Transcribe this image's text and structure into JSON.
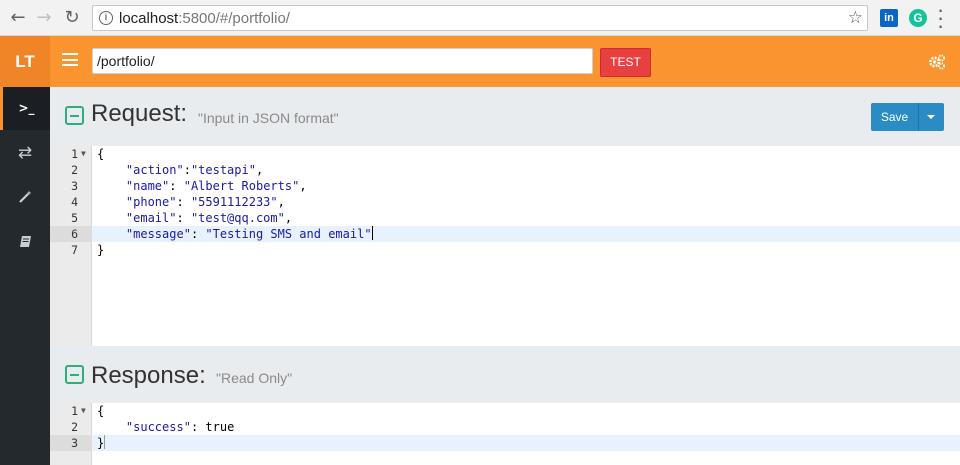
{
  "browser": {
    "url_host": "localhost",
    "url_rest": ":5800/#/portfolio/",
    "ext_linkedin": "in",
    "ext_grammarly": "G"
  },
  "header": {
    "logo": "LT",
    "path_value": "/portfolio/",
    "test_label": "TEST",
    "accent": "#f9942e"
  },
  "sidebar": {
    "items": [
      {
        "icon": "terminal-icon",
        "glyph": ">_"
      },
      {
        "icon": "exchange-icon",
        "glyph": "⇄"
      },
      {
        "icon": "magic-wand-icon",
        "glyph": "⁄"
      },
      {
        "icon": "book-icon",
        "glyph": "▰"
      }
    ]
  },
  "request": {
    "title": "Request:",
    "hint": "\"Input in JSON format\"",
    "save_label": "Save",
    "lines": [
      {
        "n": "1",
        "fold": true
      },
      {
        "n": "2"
      },
      {
        "n": "3"
      },
      {
        "n": "4"
      },
      {
        "n": "5"
      },
      {
        "n": "6"
      },
      {
        "n": "7"
      }
    ],
    "code": {
      "l1": "{",
      "l2_key": "\"action\"",
      "l2_sep": ":",
      "l2_val": "\"testapi\"",
      "l2_end": ",",
      "l3_key": "\"name\"",
      "l3_val": "\"Albert Roberts\"",
      "l4_key": "\"phone\"",
      "l4_val": "\"5591112233\"",
      "l5_key": "\"email\"",
      "l5_val": "\"test@qq.com\"",
      "l6_key": "\"message\"",
      "l6_val": "\"Testing SMS and email\"",
      "l7": "}"
    }
  },
  "response": {
    "title": "Response:",
    "hint": "\"Read Only\"",
    "lines": [
      {
        "n": "1",
        "fold": true
      },
      {
        "n": "2"
      },
      {
        "n": "3"
      }
    ],
    "code": {
      "l1": "{",
      "l2_key": "\"success\"",
      "l2_val": "true",
      "l3": "}"
    }
  }
}
